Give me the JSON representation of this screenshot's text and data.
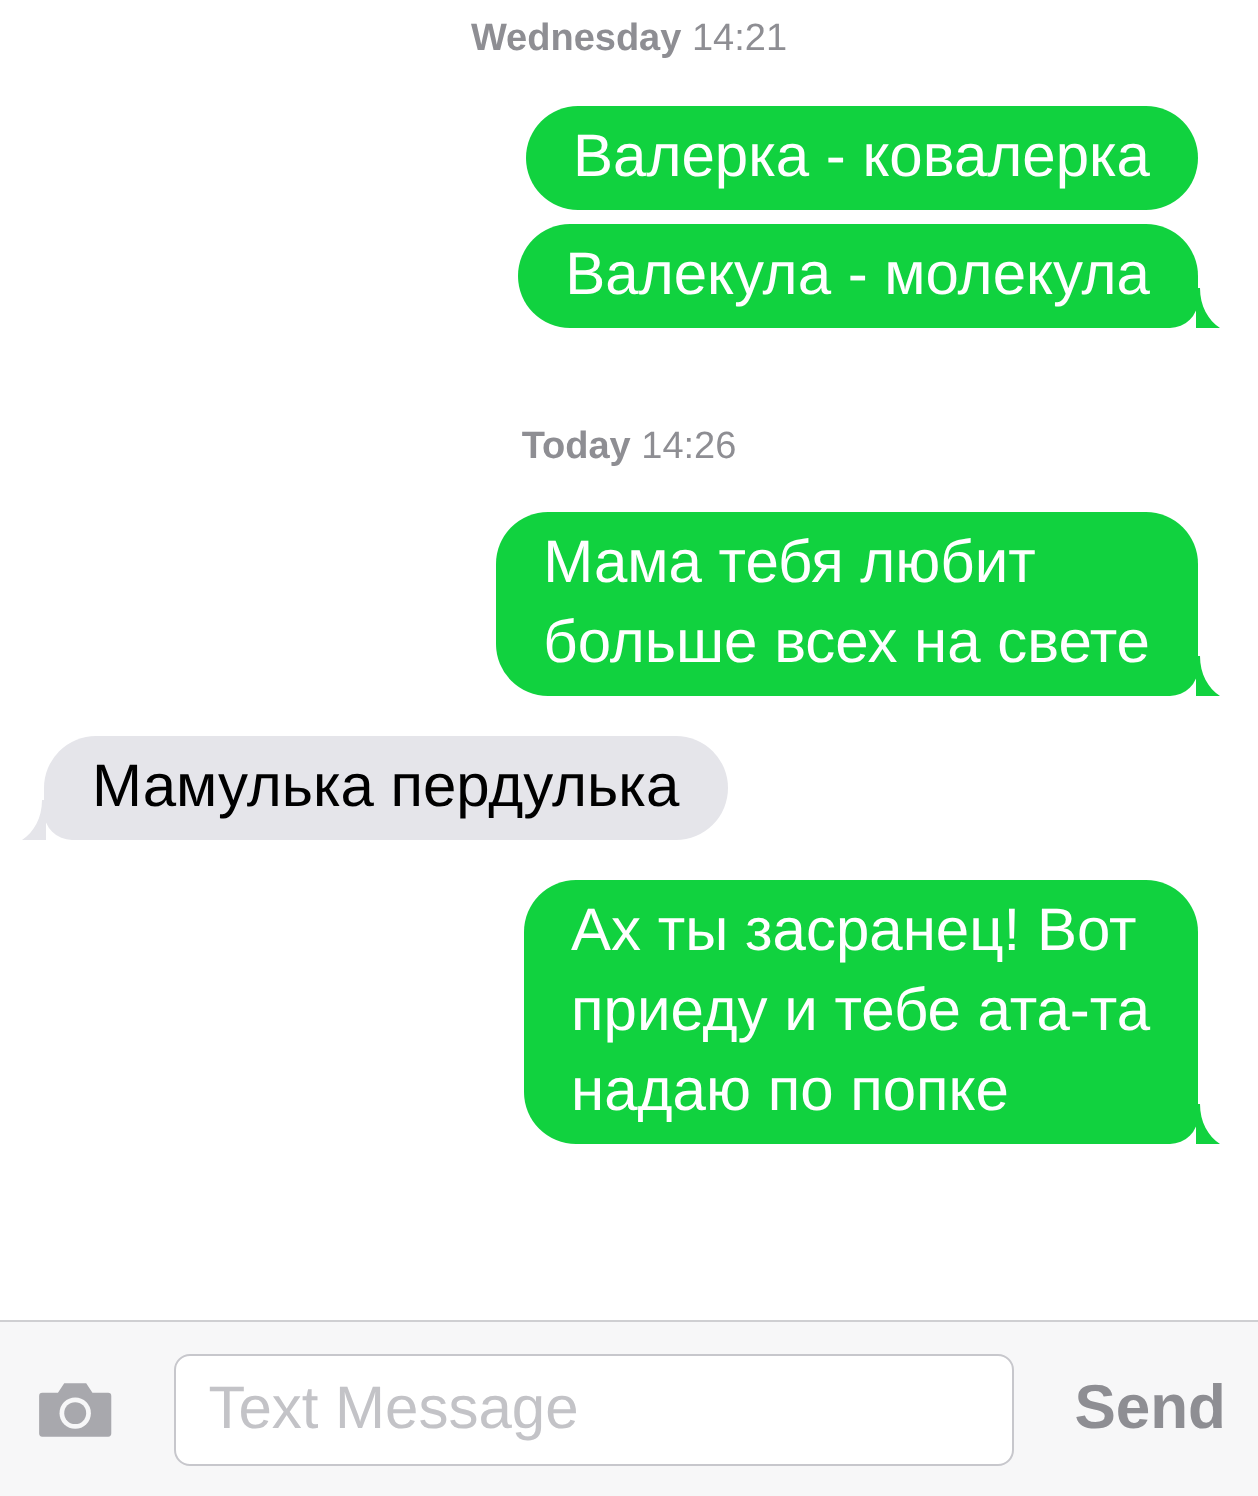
{
  "messages": [
    {
      "kind": "timestamp",
      "text": "**Wednesday** 14:21"
    },
    {
      "kind": "sent",
      "lines": [
        "Валерка - ковалерка"
      ],
      "tail": false
    },
    {
      "kind": "sent",
      "lines": [
        "Валекула - молекула"
      ],
      "tail": true
    },
    {
      "kind": "timestamp",
      "text": "**Today** 14:26"
    },
    {
      "kind": "sent",
      "lines": [
        "Мама тебя любит",
        "больше всех на свете"
      ],
      "tail": true
    },
    {
      "kind": "received",
      "lines": [
        "Мамулька пердулька"
      ],
      "tail": true
    },
    {
      "kind": "sent",
      "lines": [
        "Ах ты засранец! Вот",
        "приеду и тебе ата-та",
        "надаю по попке"
      ],
      "tail": true
    }
  ],
  "composer": {
    "placeholder": "Text Message",
    "send": "Send"
  }
}
